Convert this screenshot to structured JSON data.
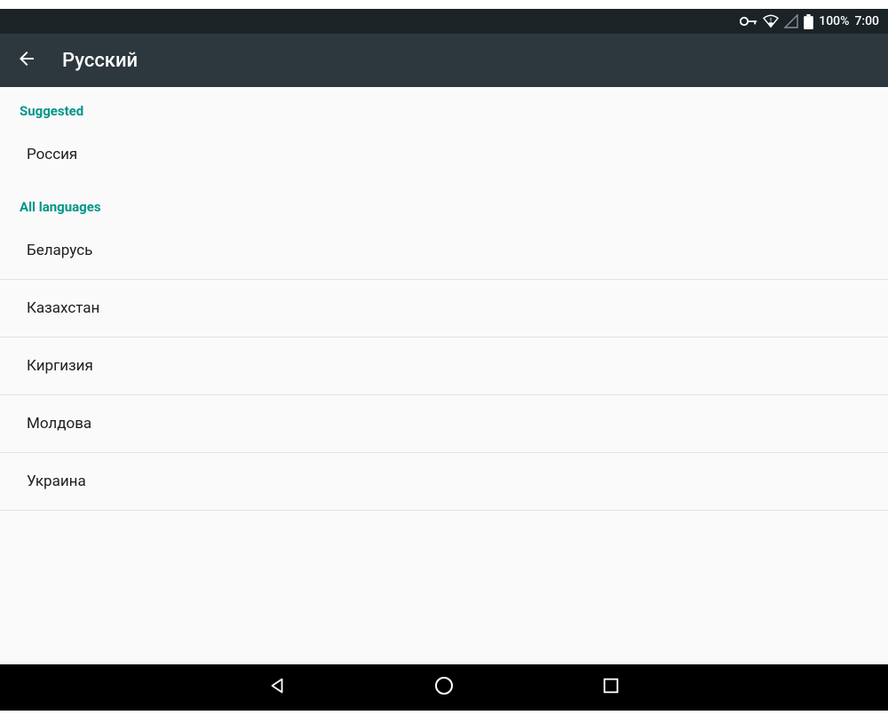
{
  "status": {
    "battery_pct": "100%",
    "clock": "7:00"
  },
  "appbar": {
    "title": "Русский"
  },
  "sections": {
    "suggested_label": "Suggested",
    "all_label": "All languages"
  },
  "suggested": [
    "Россия"
  ],
  "all": [
    "Беларусь",
    "Казахстан",
    "Киргизия",
    "Молдова",
    "Украина"
  ]
}
